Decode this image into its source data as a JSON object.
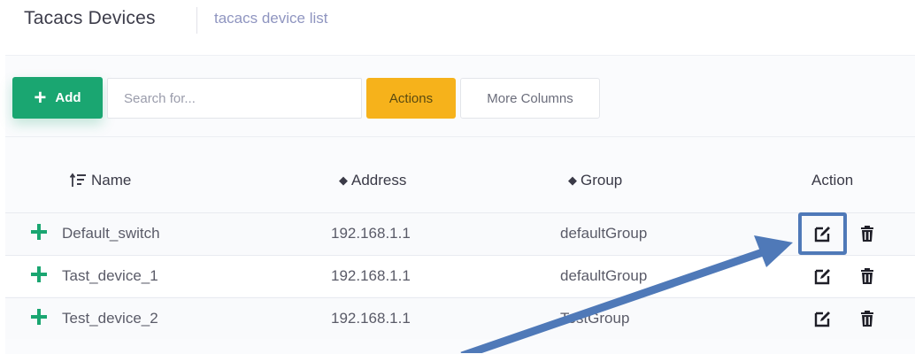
{
  "header": {
    "title": "Tacacs Devices",
    "subtitle": "tacacs device list"
  },
  "toolbar": {
    "add_label": "Add",
    "search_placeholder": "Search for...",
    "actions_label": "Actions",
    "more_columns_label": "More Columns"
  },
  "table": {
    "columns": {
      "name": "Name",
      "address": "Address",
      "group": "Group",
      "action": "Action"
    },
    "rows": [
      {
        "name": "Default_switch",
        "address": "192.168.1.1",
        "group": "defaultGroup"
      },
      {
        "name": "Tast_device_1",
        "address": "192.168.1.1",
        "group": "defaultGroup"
      },
      {
        "name": "Test_device_2",
        "address": "192.168.1.1",
        "group": "TestGroup"
      }
    ]
  },
  "colors": {
    "add_green": "#1aa671",
    "actions_yellow": "#f6b21b",
    "highlight_blue": "#4f79b8"
  },
  "icons": [
    "plus-icon",
    "sort-ascending-icon",
    "sort-icon",
    "expand-row-icon",
    "edit-icon",
    "trash-icon",
    "annotation-arrow"
  ]
}
